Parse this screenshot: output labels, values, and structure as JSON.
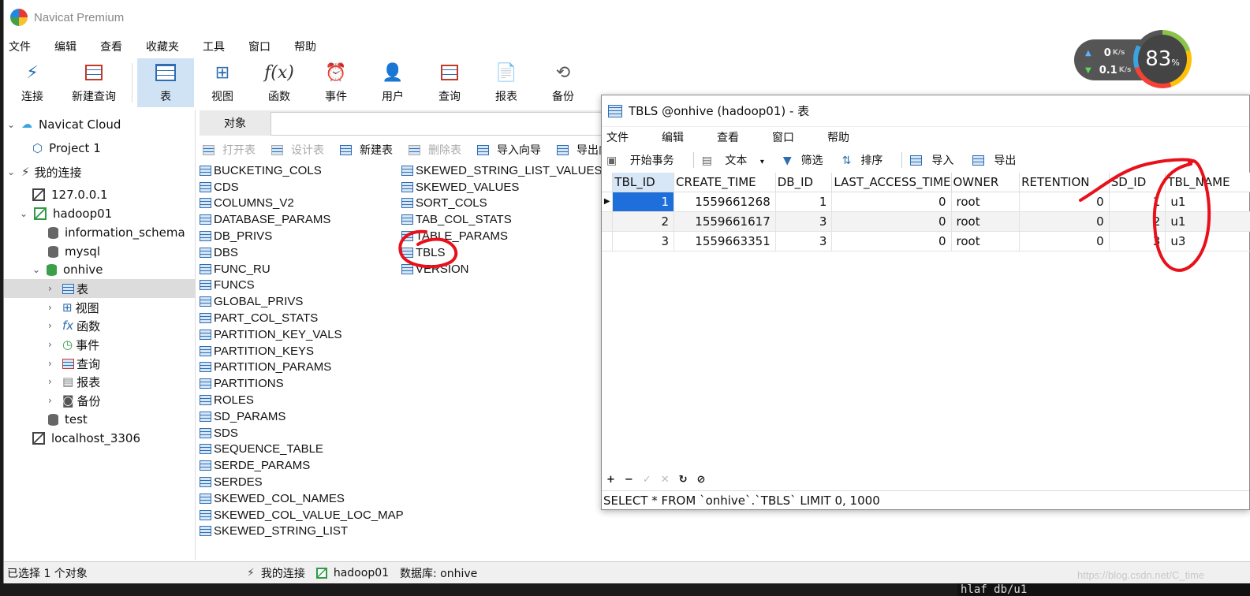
{
  "app": {
    "title": "Navicat Premium"
  },
  "menu": [
    "文件",
    "编辑",
    "查看",
    "收藏夹",
    "工具",
    "窗口",
    "帮助"
  ],
  "toolbar": [
    {
      "label": "连接",
      "icon": "connect-icon"
    },
    {
      "label": "新建查询",
      "icon": "new-query-icon"
    },
    {
      "label": "表",
      "icon": "table-icon",
      "active": true
    },
    {
      "label": "视图",
      "icon": "view-icon"
    },
    {
      "label": "函数",
      "icon": "function-icon"
    },
    {
      "label": "事件",
      "icon": "event-icon"
    },
    {
      "label": "用户",
      "icon": "user-icon"
    },
    {
      "label": "查询",
      "icon": "query-icon"
    },
    {
      "label": "报表",
      "icon": "report-icon"
    },
    {
      "label": "备份",
      "icon": "backup-icon"
    }
  ],
  "sidebar": {
    "navicat_cloud": "Navicat Cloud",
    "project": "Project 1",
    "my_connections": "我的连接",
    "conn_local": "127.0.0.1",
    "conn_hadoop": "hadoop01",
    "db_info": "information_schema",
    "db_mysql": "mysql",
    "db_onhive": "onhive",
    "node_tables": "表",
    "node_views": "视图",
    "node_functions": "函数",
    "node_events": "事件",
    "node_queries": "查询",
    "node_reports": "报表",
    "node_backups": "备份",
    "db_test": "test",
    "conn_localhost": "localhost_3306"
  },
  "objects": {
    "tab": "对象",
    "toolbar": {
      "open": "打开表",
      "design": "设计表",
      "new": "新建表",
      "delete": "删除表",
      "import": "导入向导",
      "export": "导出向导"
    },
    "col1": [
      "BUCKETING_COLS",
      "CDS",
      "COLUMNS_V2",
      "DATABASE_PARAMS",
      "DB_PRIVS",
      "DBS",
      "FUNC_RU",
      "FUNCS",
      "GLOBAL_PRIVS",
      "PART_COL_STATS",
      "PARTITION_KEY_VALS",
      "PARTITION_KEYS",
      "PARTITION_PARAMS",
      "PARTITIONS",
      "ROLES",
      "SD_PARAMS",
      "SDS",
      "SEQUENCE_TABLE",
      "SERDE_PARAMS",
      "SERDES",
      "SKEWED_COL_NAMES",
      "SKEWED_COL_VALUE_LOC_MAP",
      "SKEWED_STRING_LIST"
    ],
    "col2": [
      "SKEWED_STRING_LIST_VALUES",
      "SKEWED_VALUES",
      "SORT_COLS",
      "TAB_COL_STATS",
      "TABLE_PARAMS",
      "TBLS",
      "VERSION"
    ]
  },
  "status": {
    "selected": "已选择 1 个对象",
    "connection": "我的连接",
    "server": "hadoop01",
    "database": "数据库: onhive"
  },
  "tbls_window": {
    "title": "TBLS @onhive (hadoop01) - 表",
    "menu": [
      "文件",
      "编辑",
      "查看",
      "窗口",
      "帮助"
    ],
    "toolbar": {
      "begin_tx": "开始事务",
      "text": "文本",
      "filter": "筛选",
      "sort": "排序",
      "import": "导入",
      "export": "导出"
    },
    "columns": [
      "TBL_ID",
      "CREATE_TIME",
      "DB_ID",
      "LAST_ACCESS_TIME",
      "OWNER",
      "RETENTION",
      "SD_ID",
      "TBL_NAME"
    ],
    "rows": [
      [
        "1",
        "1559661268",
        "1",
        "0",
        "root",
        "0",
        "1",
        "u1"
      ],
      [
        "2",
        "1559661617",
        "3",
        "0",
        "root",
        "0",
        "2",
        "u1"
      ],
      [
        "3",
        "1559663351",
        "3",
        "0",
        "root",
        "0",
        "3",
        "u3"
      ]
    ],
    "sql": "SELECT * FROM `onhive`.`TBLS` LIMIT 0, 1000"
  },
  "netmon": {
    "up": "0",
    "down": "0.1",
    "unit": "K/s",
    "percent": "83",
    "percent_unit": "%"
  },
  "watermark": "https://blog.csdn.net/C_time",
  "terminal": "hlaf db/u1",
  "colors": {
    "selection": "#1e6fd9",
    "annotation": "#e8101a",
    "active_tool": "#cfe3f5"
  }
}
